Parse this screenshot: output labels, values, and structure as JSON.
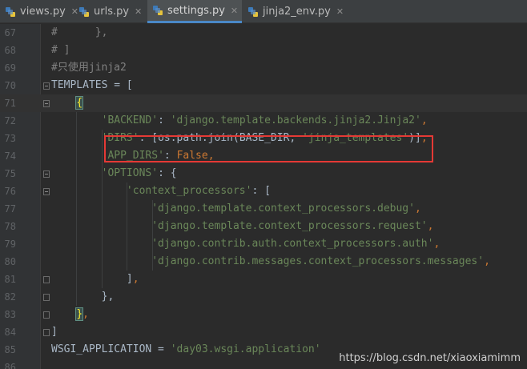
{
  "tabs": [
    {
      "label": "views.py",
      "active": false
    },
    {
      "label": "urls.py",
      "active": false
    },
    {
      "label": "settings.py",
      "active": true
    },
    {
      "label": "jinja2_env.py",
      "active": false
    }
  ],
  "lines": [
    {
      "num": "67",
      "segments": [
        [
          "cm",
          "#      },"
        ]
      ]
    },
    {
      "num": "68",
      "segments": [
        [
          "cm",
          "# ]"
        ]
      ]
    },
    {
      "num": "69",
      "segments": [
        [
          "cm",
          "#只使用jinja2"
        ]
      ]
    },
    {
      "num": "70",
      "segments": [
        [
          "punc",
          "TEMPLATES = ["
        ]
      ]
    },
    {
      "num": "71",
      "segments": [
        [
          "punc",
          "    "
        ],
        [
          "brace",
          "{"
        ]
      ]
    },
    {
      "num": "72",
      "segments": [
        [
          "punc",
          "        "
        ],
        [
          "str",
          "'BACKEND'"
        ],
        [
          "punc",
          ": "
        ],
        [
          "str",
          "'django.template.backends.jinja2.Jinja2'"
        ],
        [
          "kw",
          ","
        ]
      ]
    },
    {
      "num": "73",
      "segments": [
        [
          "punc",
          "        "
        ],
        [
          "str",
          "'DIRS'"
        ],
        [
          "punc",
          ": [os.path.join(BASE_DIR, "
        ],
        [
          "str",
          "'jinja_templates'"
        ],
        [
          "punc",
          ")]"
        ],
        [
          "kw",
          ","
        ]
      ]
    },
    {
      "num": "74",
      "segments": [
        [
          "punc",
          "        "
        ],
        [
          "str",
          "'APP_DIRS'"
        ],
        [
          "punc",
          ": "
        ],
        [
          "kw",
          "False,"
        ]
      ]
    },
    {
      "num": "75",
      "segments": [
        [
          "punc",
          "        "
        ],
        [
          "str",
          "'OPTIONS'"
        ],
        [
          "punc",
          ": {"
        ]
      ]
    },
    {
      "num": "76",
      "segments": [
        [
          "punc",
          "            "
        ],
        [
          "str",
          "'context_processors'"
        ],
        [
          "punc",
          ": ["
        ]
      ]
    },
    {
      "num": "77",
      "segments": [
        [
          "punc",
          "                "
        ],
        [
          "str",
          "'django.template.context_processors.debug'"
        ],
        [
          "kw",
          ","
        ]
      ]
    },
    {
      "num": "78",
      "segments": [
        [
          "punc",
          "                "
        ],
        [
          "str",
          "'django.template.context_processors.request'"
        ],
        [
          "kw",
          ","
        ]
      ]
    },
    {
      "num": "79",
      "segments": [
        [
          "punc",
          "                "
        ],
        [
          "str",
          "'django.contrib.auth.context_processors.auth'"
        ],
        [
          "kw",
          ","
        ]
      ]
    },
    {
      "num": "80",
      "segments": [
        [
          "punc",
          "                "
        ],
        [
          "str",
          "'django.contrib.messages.context_processors.messages'"
        ],
        [
          "kw",
          ","
        ]
      ]
    },
    {
      "num": "81",
      "segments": [
        [
          "punc",
          "            ]"
        ],
        [
          "kw",
          ","
        ]
      ]
    },
    {
      "num": "82",
      "segments": [
        [
          "punc",
          "        },"
        ]
      ]
    },
    {
      "num": "83",
      "segments": [
        [
          "punc",
          "    "
        ],
        [
          "brace",
          "}"
        ],
        [
          "kw",
          ","
        ]
      ]
    },
    {
      "num": "84",
      "segments": [
        [
          "punc",
          "]"
        ]
      ]
    },
    {
      "num": "85",
      "segments": [
        [
          "punc",
          "WSGI_APPLICATION = "
        ],
        [
          "str",
          "'day03.wsgi.application'"
        ]
      ]
    },
    {
      "num": "86",
      "segments": []
    }
  ],
  "watermark": "https://blog.csdn.net/xiaoxiamimm",
  "colors": {
    "background": "#2b2b2b",
    "string": "#6a8759",
    "keyword": "#cc7832",
    "comment": "#808080",
    "text": "#a9b7c6",
    "annotation_box": "#e53935"
  }
}
